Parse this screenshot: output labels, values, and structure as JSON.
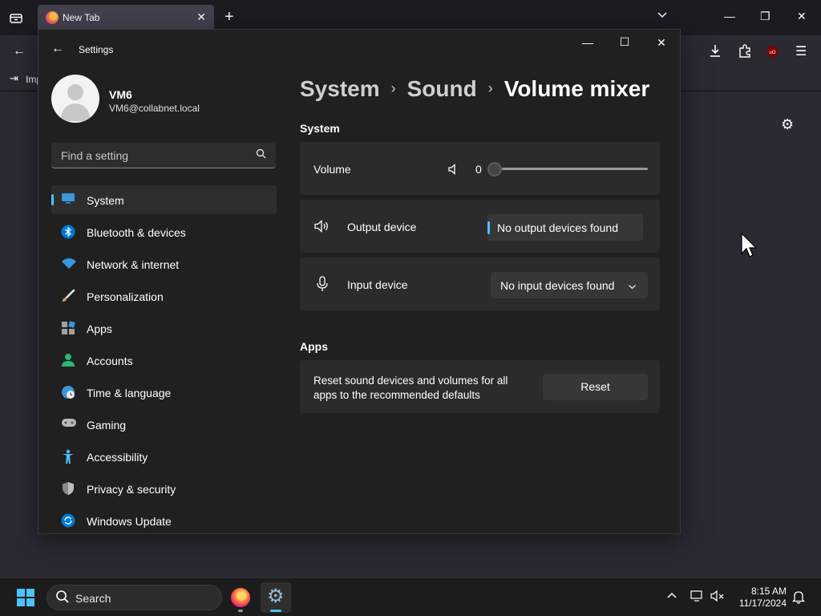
{
  "firefox": {
    "tab_title": "New Tab",
    "bookmark_import_label": "Imp"
  },
  "settings": {
    "app_title": "Settings",
    "user": {
      "name": "VM6",
      "email": "VM6@collabnet.local"
    },
    "search_placeholder": "Find a setting",
    "nav": [
      {
        "label": "System",
        "icon": "system-icon",
        "active": true
      },
      {
        "label": "Bluetooth & devices",
        "icon": "bluetooth-icon"
      },
      {
        "label": "Network & internet",
        "icon": "wifi-icon"
      },
      {
        "label": "Personalization",
        "icon": "brush-icon"
      },
      {
        "label": "Apps",
        "icon": "apps-icon"
      },
      {
        "label": "Accounts",
        "icon": "accounts-icon"
      },
      {
        "label": "Time & language",
        "icon": "time-language-icon"
      },
      {
        "label": "Gaming",
        "icon": "gamepad-icon"
      },
      {
        "label": "Accessibility",
        "icon": "accessibility-icon"
      },
      {
        "label": "Privacy & security",
        "icon": "shield-icon"
      },
      {
        "label": "Windows Update",
        "icon": "update-icon"
      }
    ],
    "breadcrumb": {
      "level1": "System",
      "level2": "Sound",
      "current": "Volume mixer"
    },
    "system_section": {
      "title": "System",
      "volume_label": "Volume",
      "volume_value": "0",
      "output_label": "Output device",
      "output_value": "No output devices found",
      "input_label": "Input device",
      "input_value": "No input devices found"
    },
    "apps_section": {
      "title": "Apps",
      "reset_line1": "Reset sound devices and volumes for all",
      "reset_line2": "apps to the recommended defaults",
      "reset_button": "Reset"
    }
  },
  "taskbar": {
    "search_label": "Search",
    "time": "8:15 AM",
    "date": "11/17/2024"
  },
  "colors": {
    "accent": "#4cc2ff",
    "card": "#2b2b2b",
    "window": "#202020"
  }
}
